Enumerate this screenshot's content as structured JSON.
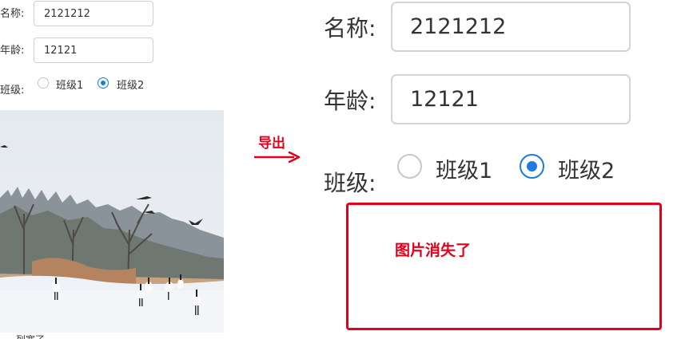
{
  "small_form": {
    "name_label": "名称:",
    "name_value": "2121212",
    "age_label": "年龄:",
    "age_value": "12121",
    "class_label": "班级:",
    "class_options": [
      "班级1",
      "班级2"
    ],
    "class_selected": "班级2",
    "caption_partial": "列宽了"
  },
  "arrow": {
    "label": "导出"
  },
  "export_preview": {
    "name_label": "名称:",
    "name_value": "2121212",
    "age_label": "年龄:",
    "age_value": "12121",
    "class_label": "班级:",
    "class_options": [
      "班级1",
      "班级2"
    ],
    "class_selected": "班级2",
    "missing_image_note": "图片消失了"
  },
  "colors": {
    "accent": "#1d7be0",
    "annotation_red": "#e2001a"
  }
}
